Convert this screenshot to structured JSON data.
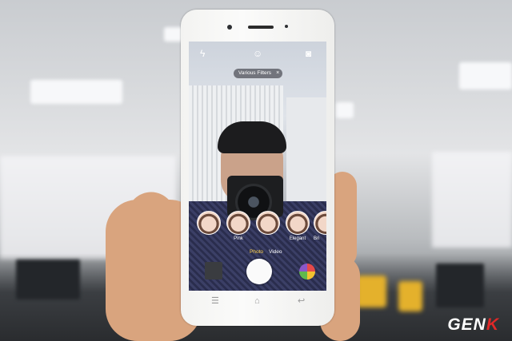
{
  "watermark": {
    "text_main": "GEN",
    "text_accent": "K"
  },
  "camera_app": {
    "top_icons": [
      "flash-icon",
      "face-beauty-icon",
      "switch-camera-icon"
    ],
    "filter_chip": {
      "label": "Various Filters",
      "close": "×"
    },
    "filters": [
      {
        "label": ""
      },
      {
        "label": "Pink"
      },
      {
        "label": ""
      },
      {
        "label": "Elegant"
      },
      {
        "label": "Bri"
      }
    ],
    "modes": {
      "left": "Photo",
      "right": "Video",
      "active": "Photo"
    },
    "shutter_icon": "shutter-button"
  },
  "nav_keys": {
    "menu": "☰",
    "home": "⌂",
    "back": "↩"
  },
  "colors": {
    "accent": "#ffd24a",
    "logo_accent": "#e02828"
  }
}
